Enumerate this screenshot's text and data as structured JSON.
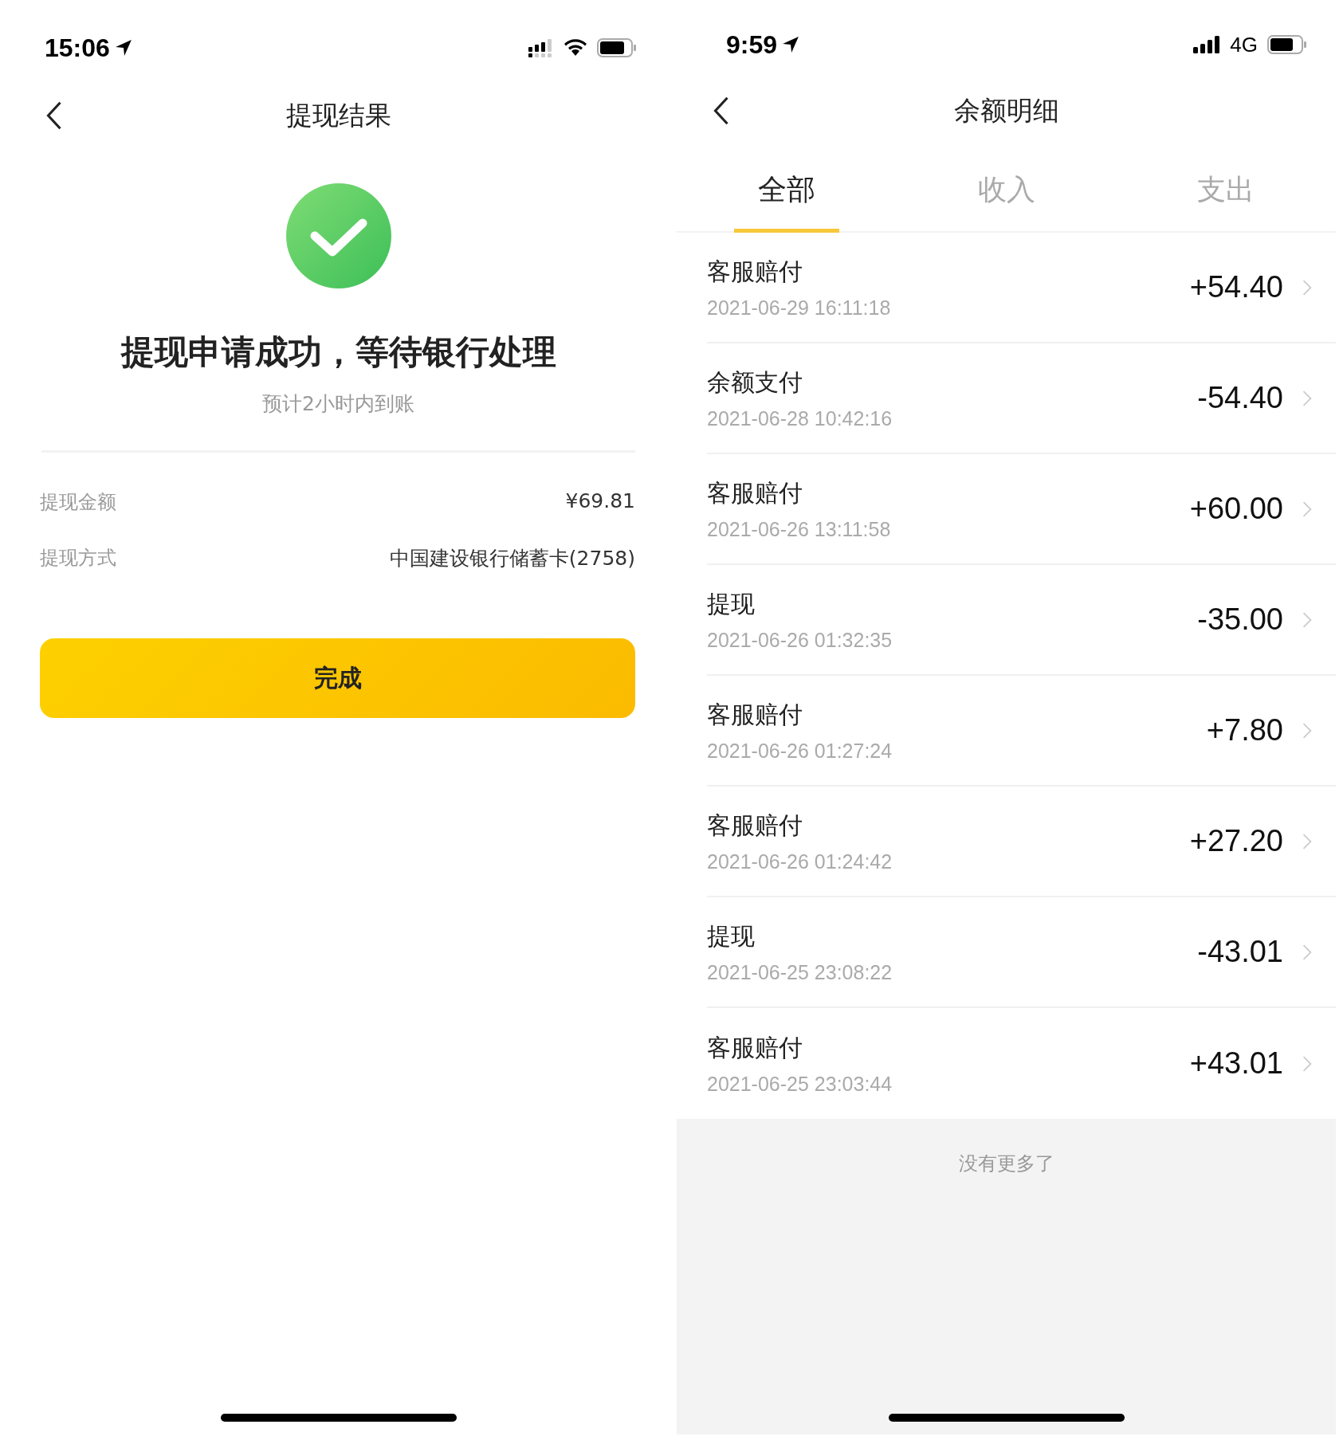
{
  "left": {
    "status_bar": {
      "time": "15:06"
    },
    "nav": {
      "title": "提现结果"
    },
    "result": {
      "heading": "提现申请成功，等待银行处理",
      "subtitle": "预计2小时内到账"
    },
    "details": [
      {
        "label": "提现金额",
        "value": "¥69.81"
      },
      {
        "label": "提现方式",
        "value": "中国建设银行储蓄卡(2758)"
      }
    ],
    "button": "完成"
  },
  "right": {
    "status_bar": {
      "time": "9:59",
      "network": "4G"
    },
    "nav": {
      "title": "余额明细"
    },
    "tabs": [
      {
        "label": "全部",
        "selected": true
      },
      {
        "label": "收入",
        "selected": false
      },
      {
        "label": "支出",
        "selected": false
      }
    ],
    "rows": [
      {
        "title": "客服赔付",
        "datetime": "2021-06-29 16:11:18",
        "amount": "+54.40"
      },
      {
        "title": "余额支付",
        "datetime": "2021-06-28 10:42:16",
        "amount": "-54.40"
      },
      {
        "title": "客服赔付",
        "datetime": "2021-06-26 13:11:58",
        "amount": "+60.00"
      },
      {
        "title": "提现",
        "datetime": "2021-06-26 01:32:35",
        "amount": "-35.00"
      },
      {
        "title": "客服赔付",
        "datetime": "2021-06-26 01:27:24",
        "amount": "+7.80"
      },
      {
        "title": "客服赔付",
        "datetime": "2021-06-26 01:24:42",
        "amount": "+27.20"
      },
      {
        "title": "提现",
        "datetime": "2021-06-25 23:08:22",
        "amount": "-43.01"
      },
      {
        "title": "客服赔付",
        "datetime": "2021-06-25 23:03:44",
        "amount": "+43.01"
      }
    ],
    "footer": "没有更多了"
  }
}
